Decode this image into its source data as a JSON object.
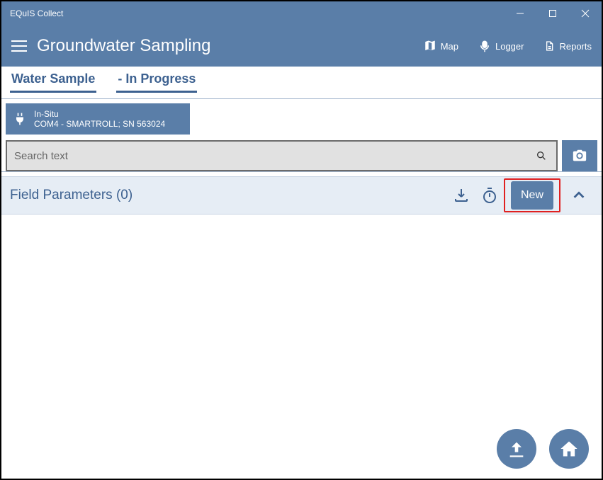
{
  "window": {
    "title": "EQuIS Collect"
  },
  "header": {
    "title": "Groundwater Sampling",
    "buttons": {
      "map": "Map",
      "logger": "Logger",
      "reports": "Reports"
    }
  },
  "tabs": {
    "primary": "Water Sample",
    "secondary": "- In Progress"
  },
  "device": {
    "name": "In-Situ",
    "detail": "COM4 - SMARTROLL; SN 563024"
  },
  "search": {
    "placeholder": "Search text"
  },
  "section": {
    "title": "Field Parameters (0)",
    "new_label": "New"
  }
}
